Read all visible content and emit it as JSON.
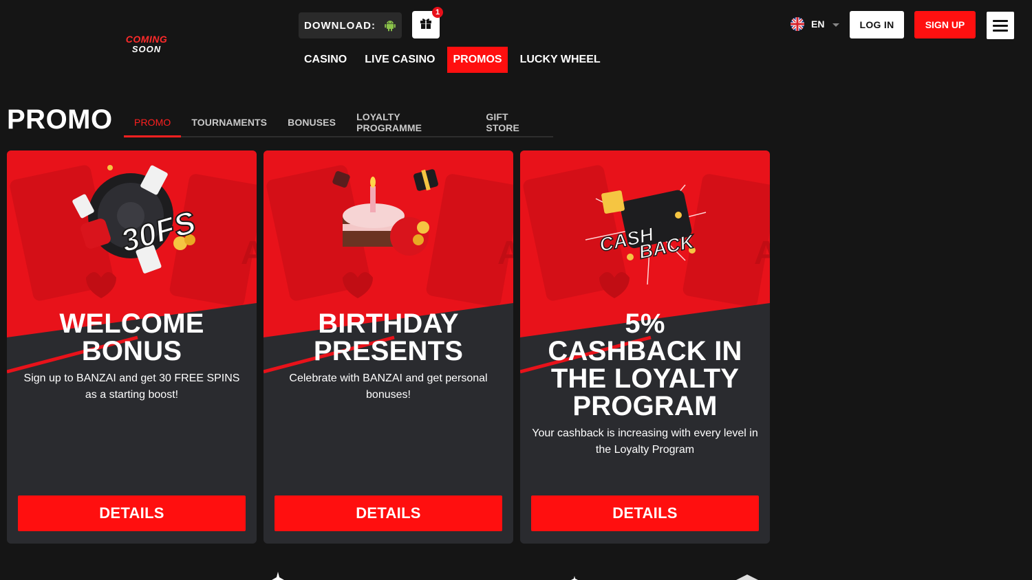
{
  "header": {
    "logo_line1": "COMING",
    "logo_line2": "SOON",
    "download_label": "DOWNLOAD:",
    "gift_badge_count": "1",
    "nav": [
      {
        "label": "CASINO",
        "active": false
      },
      {
        "label": "LIVE CASINO",
        "active": false
      },
      {
        "label": "PROMOS",
        "active": true
      },
      {
        "label": "LUCKY WHEEL",
        "active": false
      }
    ],
    "language": "EN",
    "login_label": "LOG IN",
    "signup_label": "SIGN UP"
  },
  "promo": {
    "title": "PROMO",
    "tabs": [
      {
        "label": "PROMO",
        "active": true
      },
      {
        "label": "TOURNAMENTS",
        "active": false
      },
      {
        "label": "BONUSES",
        "active": false
      },
      {
        "label": "LOYALTY PROGRAMME",
        "active": false
      },
      {
        "label": "GIFT STORE",
        "active": false
      }
    ]
  },
  "cards": [
    {
      "art_text": "30FS",
      "title_line1": "WELCOME",
      "title_line2": "BONUS",
      "description": "Sign up to BANZAI and get 30 FREE SPINS as a starting boost!",
      "button_label": "DETAILS"
    },
    {
      "title_line1": "BIRTHDAY",
      "title_line2": "PRESENTS",
      "description": "Celebrate with BANZAI and get personal bonuses!",
      "button_label": "DETAILS"
    },
    {
      "art_text_1": "CASH",
      "art_text_2": "BACK",
      "title_line1": "5%",
      "title_line2": "CASHBACK IN",
      "title_line3": "THE LOYALTY",
      "title_line4": "PROGRAM",
      "description": "Your cashback is increasing with every level in the Loyalty Program",
      "button_label": "DETAILS"
    }
  ],
  "colors": {
    "accent": "#ff0f0f",
    "background": "#151515",
    "card": "#2a2b2f",
    "card_art": "#e8121a"
  },
  "icons": [
    "android-icon",
    "gift-icon",
    "uk-flag-icon",
    "chevron-down-icon",
    "hamburger-menu-icon"
  ]
}
